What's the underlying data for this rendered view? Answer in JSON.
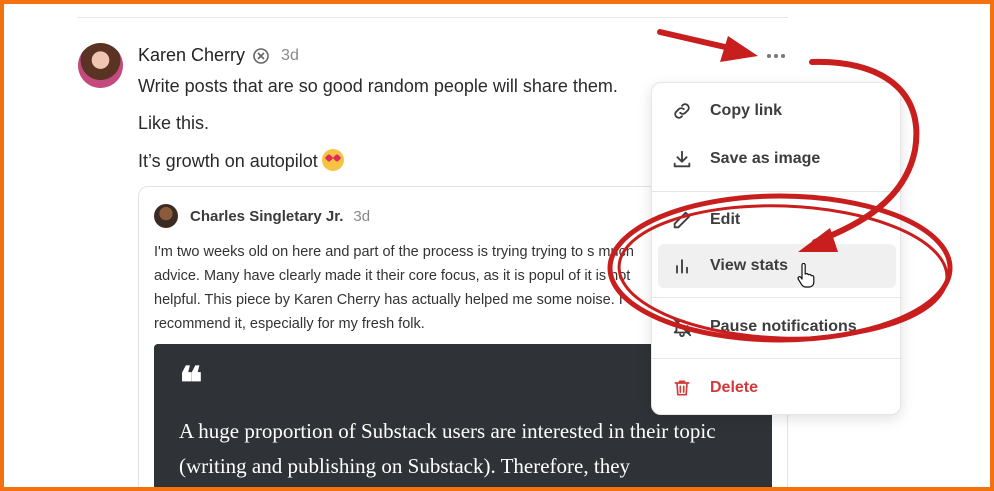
{
  "post": {
    "author": "Karen Cherry",
    "time": "3d",
    "lines": [
      "Write posts that are so good random people will share them.",
      "Like this.",
      "It’s growth on autopilot"
    ]
  },
  "quoted": {
    "author": "Charles Singletary Jr.",
    "time": "3d",
    "text": "I'm two weeks old on here and part of the process is trying trying to s much advice. Many have clearly made it their core focus, as it is popul of it is not helpful. This piece by Karen Cherry has actually helped me some noise. I recommend it, especially for my fresh folk.",
    "quote_mark": "❝",
    "quote_text": "A huge proportion of Substack users are interested in their topic (writing and publishing on Substack). Therefore, they"
  },
  "menu": {
    "items": [
      {
        "label": "Copy link",
        "icon": "link-icon"
      },
      {
        "label": "Save as image",
        "icon": "download-icon"
      },
      {
        "label": "Edit",
        "icon": "pencil-icon"
      },
      {
        "label": "View stats",
        "icon": "bar-chart-icon"
      },
      {
        "label": "Pause notifications",
        "icon": "bell-off-icon"
      },
      {
        "label": "Delete",
        "icon": "trash-icon"
      }
    ]
  },
  "colors": {
    "frame": "#f3720f",
    "annotation": "#c81e1e",
    "danger": "#d23a3a"
  }
}
